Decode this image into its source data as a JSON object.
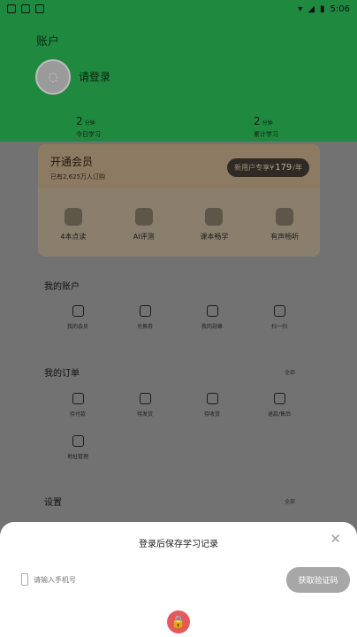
{
  "status": {
    "time": "5:06"
  },
  "header": {
    "title": "账户",
    "login": "请登录"
  },
  "stats": [
    {
      "num": "2",
      "unit": "分钟",
      "label": "今日学习"
    },
    {
      "num": "2",
      "unit": "分钟",
      "label": "累计学习"
    }
  ],
  "vip": {
    "title": "开通会员",
    "subtitle": "已有2,625万人订购",
    "price_prefix": "新用户专享¥",
    "price_value": "179",
    "price_suffix": "/年",
    "items": [
      "4本点读",
      "AI评测",
      "课本畅学",
      "有声畅听"
    ]
  },
  "account": {
    "title": "我的账户",
    "items": [
      "我的会员",
      "兑换券",
      "我的勋章",
      "扫一扫"
    ]
  },
  "orders": {
    "title": "我的订单",
    "more": "全部",
    "items": [
      "待付款",
      "待发货",
      "待收货",
      "退款/售后",
      "地址管理"
    ]
  },
  "settings": {
    "title": "设置",
    "more": "全部"
  },
  "sheet": {
    "title": "登录后保存学习记录",
    "phone_placeholder": "请输入手机号",
    "code_button": "获取验证码"
  }
}
